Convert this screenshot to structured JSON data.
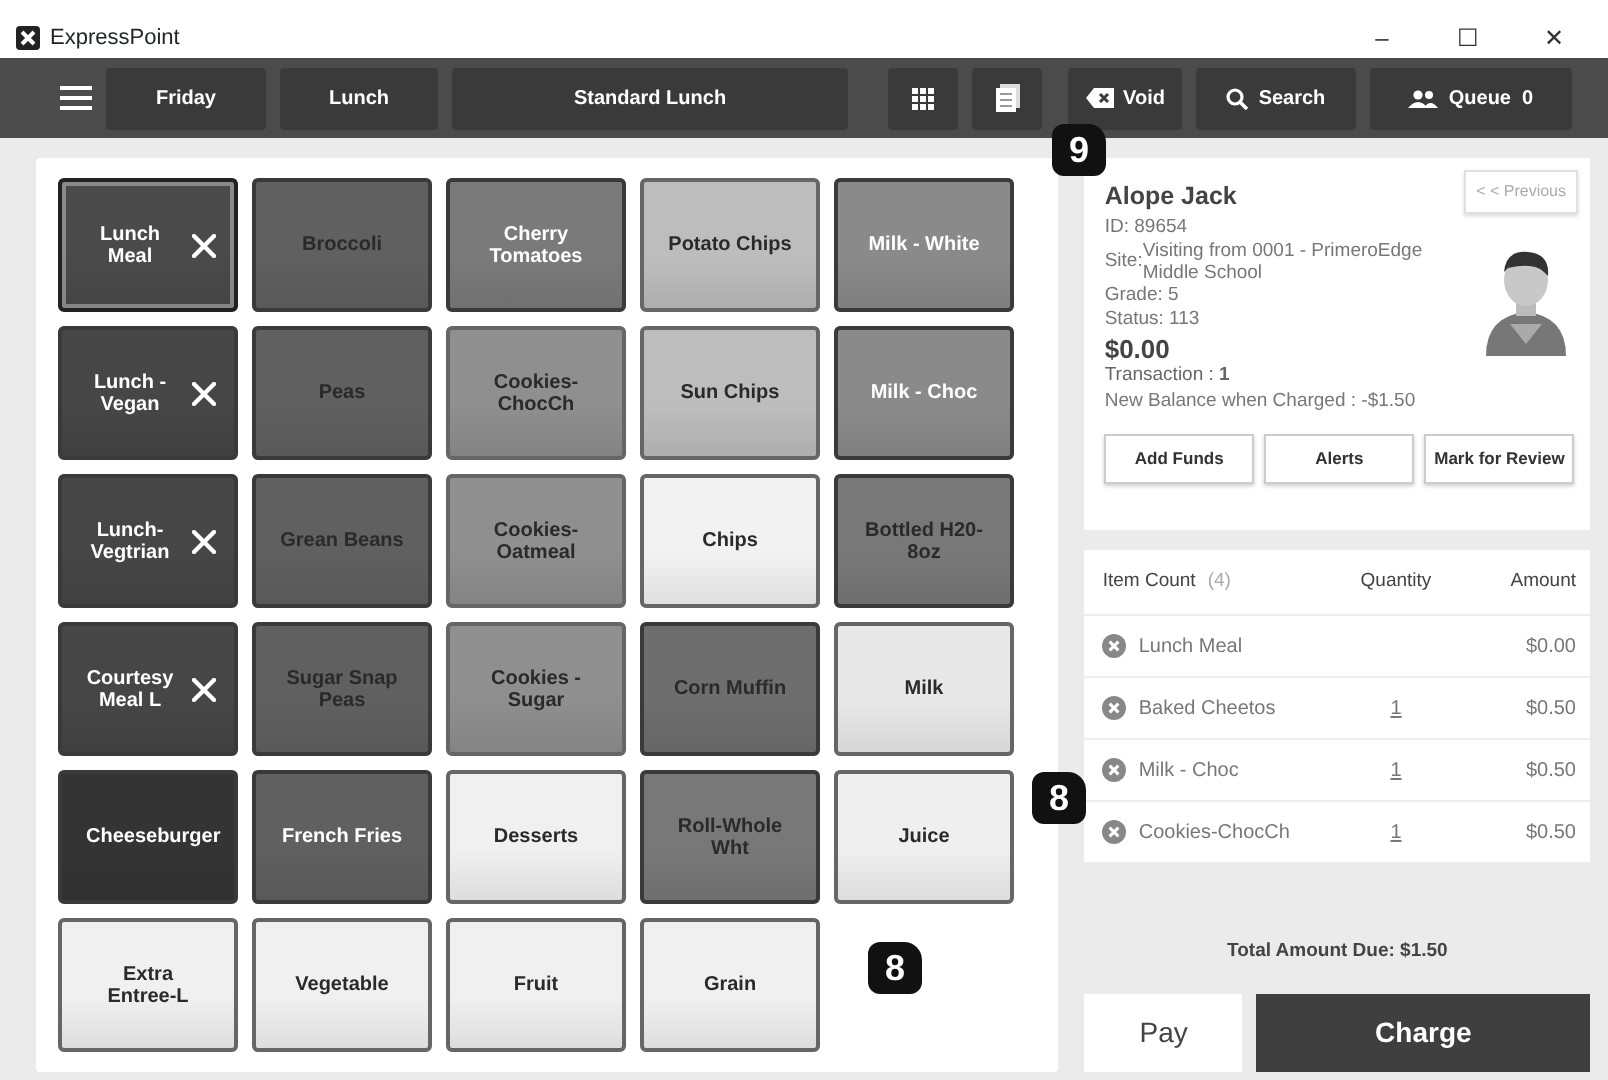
{
  "window": {
    "title": "ExpressPoint",
    "controls": [
      "–",
      "☐",
      "✕"
    ]
  },
  "toolbar": {
    "day": "Friday",
    "meal": "Lunch",
    "menu": "Standard Lunch",
    "void": "Void",
    "search": "Search",
    "queue_label": "Queue",
    "queue_count": "0"
  },
  "tiles": [
    {
      "label": "Lunch Meal",
      "color": "#4a4a4a",
      "light_label": true,
      "meal": true,
      "selected": true
    },
    {
      "label": "Broccoli",
      "color": "#606060",
      "light_label": false,
      "meal": false,
      "selected": false
    },
    {
      "label": "Cherry Tomatoes",
      "color": "#7a7a7a",
      "light_label": true,
      "meal": false,
      "selected": false
    },
    {
      "label": "Potato Chips",
      "color": "#bdbdbd",
      "light_label": false,
      "meal": false,
      "selected": false
    },
    {
      "label": "Milk - White",
      "color": "#8a8a8a",
      "light_label": true,
      "meal": false,
      "selected": false
    },
    {
      "label": "Lunch - Vegan",
      "color": "#464646",
      "light_label": true,
      "meal": true,
      "selected": false
    },
    {
      "label": "Peas",
      "color": "#606060",
      "light_label": false,
      "meal": false,
      "selected": false
    },
    {
      "label": "Cookies-ChocCh",
      "color": "#8f8f8f",
      "light_label": false,
      "meal": false,
      "selected": false
    },
    {
      "label": "Sun Chips",
      "color": "#bdbdbd",
      "light_label": false,
      "meal": false,
      "selected": false
    },
    {
      "label": "Milk - Choc",
      "color": "#8a8a8a",
      "light_label": true,
      "meal": false,
      "selected": false
    },
    {
      "label": "Lunch-Vegtrian",
      "color": "#464646",
      "light_label": true,
      "meal": true,
      "selected": false
    },
    {
      "label": "Grean Beans",
      "color": "#606060",
      "light_label": false,
      "meal": false,
      "selected": false
    },
    {
      "label": "Cookies-Oatmeal",
      "color": "#8f8f8f",
      "light_label": false,
      "meal": false,
      "selected": false
    },
    {
      "label": "Chips",
      "color": "#f2f2f2",
      "light_label": false,
      "meal": false,
      "selected": false
    },
    {
      "label": "Bottled H20-8oz",
      "color": "#787878",
      "light_label": false,
      "meal": false,
      "selected": false
    },
    {
      "label": "Courtesy Meal L",
      "color": "#464646",
      "light_label": true,
      "meal": true,
      "selected": false
    },
    {
      "label": "Sugar Snap Peas",
      "color": "#606060",
      "light_label": false,
      "meal": false,
      "selected": false
    },
    {
      "label": "Cookies - Sugar",
      "color": "#8f8f8f",
      "light_label": false,
      "meal": false,
      "selected": false
    },
    {
      "label": "Corn Muffin",
      "color": "#6e6e6e",
      "light_label": false,
      "meal": false,
      "selected": false
    },
    {
      "label": "Milk",
      "color": "#e8e8e8",
      "light_label": false,
      "meal": false,
      "selected": false
    },
    {
      "label": "Cheeseburger",
      "color": "#343434",
      "light_label": true,
      "meal": false,
      "selected": false
    },
    {
      "label": "French Fries",
      "color": "#606060",
      "light_label": true,
      "meal": false,
      "selected": false
    },
    {
      "label": "Desserts",
      "color": "#f0f0f0",
      "light_label": false,
      "meal": false,
      "selected": false
    },
    {
      "label": "Roll-Whole Wht",
      "color": "#787878",
      "light_label": false,
      "meal": false,
      "selected": false
    },
    {
      "label": "Juice",
      "color": "#efefef",
      "light_label": false,
      "meal": false,
      "selected": false
    },
    {
      "label": "Extra Entree-L",
      "color": "#f0f0f0",
      "light_label": false,
      "meal": false,
      "selected": false
    },
    {
      "label": "Vegetable",
      "color": "#f0f0f0",
      "light_label": false,
      "meal": false,
      "selected": false
    },
    {
      "label": "Fruit",
      "color": "#f0f0f0",
      "light_label": false,
      "meal": false,
      "selected": false
    },
    {
      "label": "Grain",
      "color": "#f0f0f0",
      "light_label": false,
      "meal": false,
      "selected": false
    }
  ],
  "customer": {
    "name": "Alope Jack",
    "previous": "< < Previous",
    "id": "ID: 89654",
    "site_label": "Site:",
    "site": "Visiting from 0001 - PrimeroEdge Middle School",
    "grade": "Grade: 5",
    "status": "Status: 113",
    "balance": "$0.00",
    "transaction_label": "Transaction :",
    "transaction": "1",
    "new_balance": "New Balance when Charged : -$1.50",
    "buttons": [
      "Add Funds",
      "Alerts",
      "Mark for Review"
    ]
  },
  "order": {
    "item_count_label": "Item Count",
    "item_count": "(4)",
    "columns": [
      "Quantity",
      "Amount"
    ],
    "rows": [
      {
        "item": "Lunch Meal",
        "amount": "$0.00"
      },
      {
        "item": "Baked Cheetos",
        "quantity": "1",
        "amount": "$0.50"
      },
      {
        "item": "Milk - Choc",
        "quantity": "1",
        "amount": "$0.50"
      },
      {
        "item": "Cookies-ChocCh",
        "quantity": "1",
        "amount": "$0.50"
      }
    ]
  },
  "total": "Total Amount Due: $1.50",
  "actions": {
    "pay": "Pay",
    "charge": "Charge"
  },
  "callouts": [
    {
      "text": "9",
      "kind": "toolbar"
    },
    {
      "text": "8",
      "kind": "order"
    },
    {
      "text": "8",
      "kind": "tiles"
    }
  ]
}
